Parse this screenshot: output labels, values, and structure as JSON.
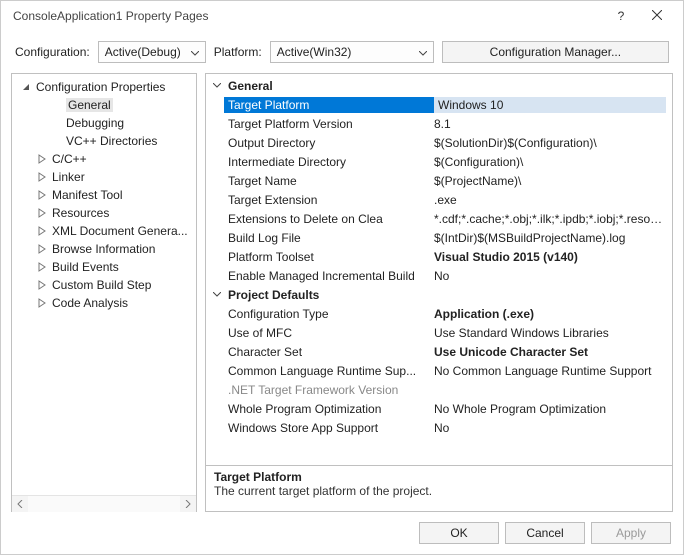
{
  "window": {
    "title": "ConsoleApplication1 Property Pages"
  },
  "toolbar": {
    "configuration_label": "Configuration:",
    "configuration_value": "Active(Debug)",
    "platform_label": "Platform:",
    "platform_value": "Active(Win32)",
    "config_manager_label": "Configuration Manager..."
  },
  "tree": {
    "root": "Configuration Properties",
    "children": [
      "General",
      "Debugging",
      "VC++ Directories"
    ],
    "selected_child": "General",
    "collapsed": [
      "C/C++",
      "Linker",
      "Manifest Tool",
      "Resources",
      "XML Document Genera...",
      "Browse Information",
      "Build Events",
      "Custom Build Step",
      "Code Analysis"
    ]
  },
  "sections": [
    {
      "name": "General",
      "rows": [
        {
          "label": "Target Platform",
          "value": "Windows 10",
          "selected": true
        },
        {
          "label": "Target Platform Version",
          "value": "8.1"
        },
        {
          "label": "Output Directory",
          "value": "$(SolutionDir)$(Configuration)\\"
        },
        {
          "label": "Intermediate Directory",
          "value": "$(Configuration)\\"
        },
        {
          "label": "Target Name",
          "value": "$(ProjectName)\\"
        },
        {
          "label": "Target Extension",
          "value": ".exe"
        },
        {
          "label": "Extensions to Delete on Clea",
          "value": "*.cdf;*.cache;*.obj;*.ilk;*.ipdb;*.iobj;*.resou..."
        },
        {
          "label": "Build Log File",
          "value": "$(IntDir)$(MSBuildProjectName).log"
        },
        {
          "label": "Platform Toolset",
          "value": "Visual Studio 2015 (v140)",
          "bold": true
        },
        {
          "label": "Enable Managed Incremental Build",
          "value": "No"
        }
      ]
    },
    {
      "name": "Project Defaults",
      "rows": [
        {
          "label": "Configuration Type",
          "value": "Application (.exe)",
          "bold": true
        },
        {
          "label": "Use of MFC",
          "value": "Use Standard Windows Libraries"
        },
        {
          "label": "Character Set",
          "value": "Use Unicode Character Set",
          "bold": true
        },
        {
          "label": "Common Language Runtime Sup...",
          "value": "No Common Language Runtime Support"
        },
        {
          "label": ".NET Target Framework Version",
          "value": "",
          "disabled": true
        },
        {
          "label": "Whole Program Optimization",
          "value": "No Whole Program Optimization"
        },
        {
          "label": "Windows Store App Support",
          "value": "No"
        }
      ]
    }
  ],
  "description": {
    "title": "Target Platform",
    "text": "The current target platform of the project."
  },
  "buttons": {
    "ok": "OK",
    "cancel": "Cancel",
    "apply": "Apply"
  }
}
